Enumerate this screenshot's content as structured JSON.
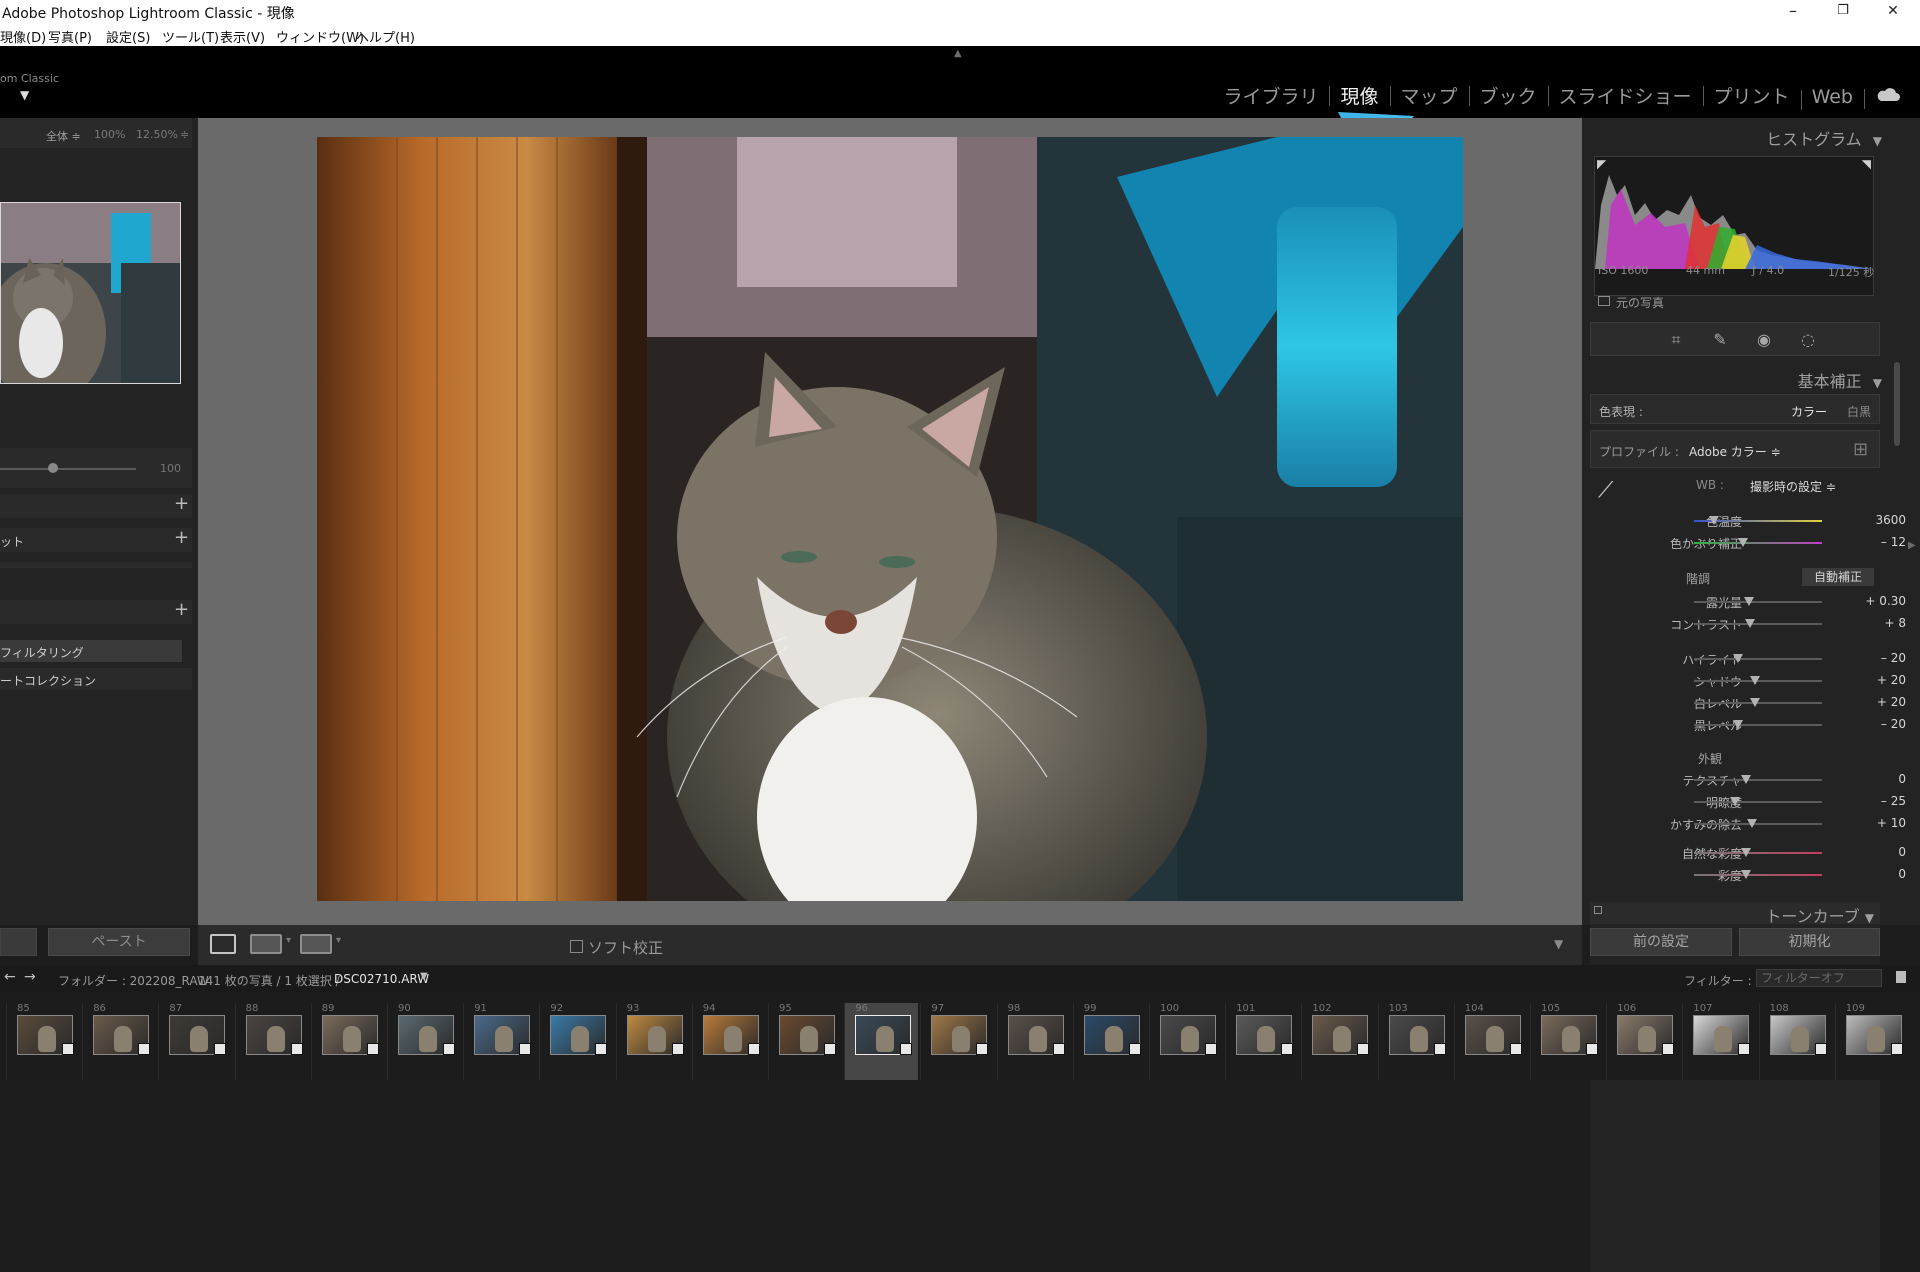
{
  "window": {
    "title": "Adobe Photoshop Lightroom Classic - 現像",
    "minimize": "–",
    "maximize": "❐",
    "close": "✕"
  },
  "menu": [
    "現像(D)",
    "写真(P)",
    "設定(S)",
    "ツール(T)",
    "表示(V)",
    "ウィンドウ(W)",
    "ヘルプ(H)"
  ],
  "identity": {
    "brand": "om Classic",
    "modules": [
      "ライブラリ",
      "現像",
      "マップ",
      "ブック",
      "スライドショー",
      "プリント",
      "Web"
    ],
    "active_module": "現像"
  },
  "navigator": {
    "fit": "全体 ≑",
    "z1": "100%",
    "z2": "12.50%"
  },
  "left_panel": {
    "slider_value": "100",
    "snapshot_label": "ット",
    "filter_item": "フィルタリング",
    "collection_item": "ートコレクション",
    "paste_label": "ペースト"
  },
  "toolbar": {
    "softproof": "ソフト校正"
  },
  "histogram": {
    "title": "ヒストグラム",
    "iso": "ISO 1600",
    "focal": "44 mm",
    "aperture": "ƒ / 4.0",
    "shutter": "1/125 秒",
    "original": "元の写真"
  },
  "basic": {
    "title": "基本補正",
    "treatment_label": "色表現 :",
    "color": "カラー",
    "bw": "白黒",
    "profile_label": "プロファイル :",
    "profile_value": "Adobe カラー ≑",
    "wb_label": "WB :",
    "wb_value": "撮影時の設定 ≑",
    "tone_label": "階調",
    "auto": "自動補正",
    "presence_label": "外観",
    "sliders": [
      {
        "label": "色温度",
        "value": "3600",
        "pos": 0.16
      },
      {
        "label": "色かぶり補正",
        "value": "– 12",
        "pos": 0.38
      },
      {
        "label": "露光量",
        "value": "+ 0.30",
        "pos": 0.43
      },
      {
        "label": "コントラスト",
        "value": "+ 8",
        "pos": 0.44
      },
      {
        "label": "ハイライト",
        "value": "– 20",
        "pos": 0.34
      },
      {
        "label": "シャドウ",
        "value": "+ 20",
        "pos": 0.48
      },
      {
        "label": "白レベル",
        "value": "+ 20",
        "pos": 0.48
      },
      {
        "label": "黒レベル",
        "value": "– 20",
        "pos": 0.34
      },
      {
        "label": "テクスチャ",
        "value": "0",
        "pos": 0.41
      },
      {
        "label": "明瞭度",
        "value": "– 25",
        "pos": 0.32
      },
      {
        "label": "かすみの除去",
        "value": "+ 10",
        "pos": 0.45
      },
      {
        "label": "自然な彩度",
        "value": "0",
        "pos": 0.41
      },
      {
        "label": "彩度",
        "value": "0",
        "pos": 0.41
      }
    ]
  },
  "tone_curve": {
    "title": "トーンカーブ"
  },
  "buttons": {
    "previous": "前の設定",
    "reset": "初期化"
  },
  "filmbar": {
    "folder": "フォルダー : 202208_RAW",
    "count": "141 枚の写真 / 1 枚選択 /",
    "file": "DSC02710.ARW",
    "filter_label": "フィルター :",
    "filter_value": "フィルターオフ"
  },
  "filmstrip": {
    "numbers": [
      "85",
      "86",
      "87",
      "88",
      "89",
      "90",
      "91",
      "92",
      "93",
      "94",
      "95",
      "96",
      "97",
      "98",
      "99",
      "100",
      "101",
      "102",
      "103",
      "104",
      "105",
      "106",
      "107",
      "108",
      "109"
    ],
    "selected": "96"
  }
}
